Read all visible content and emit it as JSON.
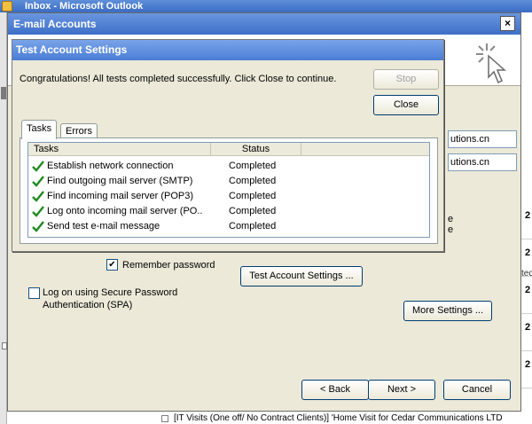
{
  "background_window": {
    "title": "Inbox - Microsoft Outlook",
    "right_list": [
      {
        "label": "2"
      },
      {
        "label": "2",
        "sub": "ted"
      },
      {
        "label": "2"
      },
      {
        "label": "2"
      },
      {
        "label": "2"
      }
    ],
    "status_line": "[IT Visits (One off/ No Contract Clients)] 'Home Visit for  Cedar Communications LTD"
  },
  "email_accounts": {
    "title": "E-mail Accounts",
    "close_glyph": "×",
    "server_fragments": [
      "utions.cn",
      "utions.cn"
    ],
    "side_fragments": [
      "e",
      "e"
    ],
    "remember_password": {
      "label": "Remember password",
      "checked": true,
      "glyph": "✔"
    },
    "spa": {
      "label_line1": "Log on using Secure Password",
      "label_line2": "Authentication (SPA)",
      "checked": false
    },
    "buttons": {
      "test_account_settings": "Test Account Settings ...",
      "more_settings": "More Settings ...",
      "back": "< Back",
      "next": "Next >",
      "cancel": "Cancel"
    }
  },
  "test_account_settings": {
    "title": "Test Account Settings",
    "message": "Congratulations! All tests completed successfully. Click Close to continue.",
    "buttons": {
      "stop": "Stop",
      "close": "Close"
    },
    "tabs": [
      {
        "label": "Tasks",
        "active": true
      },
      {
        "label": "Errors",
        "active": false
      }
    ],
    "columns": {
      "tasks": "Tasks",
      "status": "Status"
    },
    "rows": [
      {
        "task": "Establish network connection",
        "status": "Completed"
      },
      {
        "task": "Find outgoing mail server (SMTP)",
        "status": "Completed"
      },
      {
        "task": "Find incoming mail server (POP3)",
        "status": "Completed"
      },
      {
        "task": "Log onto incoming mail server (PO...",
        "status": "Completed"
      },
      {
        "task": "Send test e-mail message",
        "status": "Completed"
      }
    ],
    "check_color": "#1e8a1e"
  },
  "colors": {
    "titlebar": "#3d6fc8",
    "dialog_face": "#ece9d8"
  }
}
